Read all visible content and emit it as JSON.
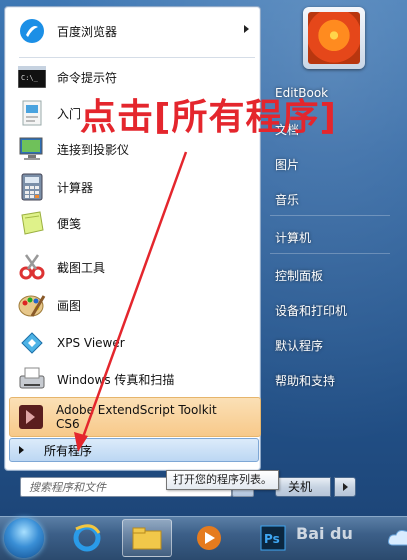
{
  "start_menu": {
    "pinned": [
      {
        "label": "百度浏览器",
        "icon": "baidu-browser-icon"
      },
      {
        "label": "命令提示符",
        "icon": "command-prompt-icon"
      },
      {
        "label": "入门",
        "icon": "getting-started-icon"
      },
      {
        "label": "连接到投影仪",
        "icon": "projector-icon"
      },
      {
        "label": "计算器",
        "icon": "calculator-icon"
      },
      {
        "label": "便笺",
        "icon": "sticky-notes-icon"
      },
      {
        "label": "截图工具",
        "icon": "snipping-tool-icon"
      },
      {
        "label": "画图",
        "icon": "paint-icon"
      },
      {
        "label": "XPS Viewer",
        "icon": "xps-viewer-icon"
      },
      {
        "label": "Windows 传真和扫描",
        "icon": "fax-scan-icon"
      },
      {
        "label": "Adobe ExtendScript Toolkit CS6",
        "icon": "adobe-extendscript-icon"
      }
    ],
    "all_programs": "所有程序",
    "search_placeholder": "搜索程序和文件"
  },
  "right_panel": {
    "items": [
      "EditBook",
      "文档",
      "图片",
      "音乐",
      "计算机",
      "控制面板",
      "设备和打印机",
      "默认程序",
      "帮助和支持"
    ],
    "shutdown": "关机"
  },
  "tooltip": "打开您的程序列表。",
  "annotation": "点击[所有程序]",
  "watermark": "Bai du",
  "colors": {
    "annotation": "#e4262d",
    "highlight": "#f7c98a"
  }
}
